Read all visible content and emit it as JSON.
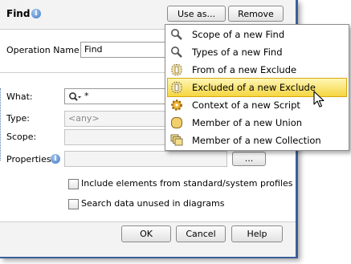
{
  "dialog": {
    "title": "Find",
    "use_as_label": "Use as...",
    "remove_label": "Remove",
    "operation_name_label": "Operation Name:",
    "operation_name_value": "Find",
    "what_label": "What:",
    "what_value": "*",
    "type_label": "Type:",
    "type_value": "<any>",
    "scope_label": "Scope:",
    "properties_label": "Properties:",
    "ellipsis_label": "...",
    "include_std_label": "Include elements from standard/system profiles",
    "search_unused_label": "Search data unused in diagrams",
    "ok_label": "OK",
    "cancel_label": "Cancel",
    "help_label": "Help"
  },
  "menu": {
    "items": [
      {
        "label": "Scope of a new Find",
        "icon": "magnifier-icon"
      },
      {
        "label": "Types of a new Find",
        "icon": "magnifier-icon"
      },
      {
        "label": "From of a new Exclude",
        "icon": "exclude-icon"
      },
      {
        "label": "Excluded of a new Exclude",
        "icon": "exclude-icon"
      },
      {
        "label": "Context of a new Script",
        "icon": "gear-icon"
      },
      {
        "label": "Member of a new Union",
        "icon": "union-icon"
      },
      {
        "label": "Member of a new Collection",
        "icon": "collection-icon"
      }
    ],
    "highlighted_index": 3
  },
  "colors": {
    "highlight": "#f5d640",
    "window_border": "#3a5e9c"
  }
}
